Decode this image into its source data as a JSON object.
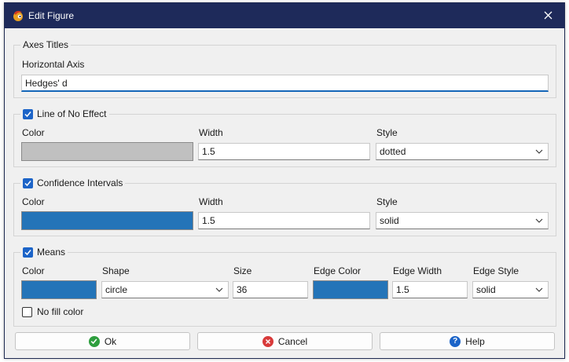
{
  "window": {
    "title": "Edit Figure"
  },
  "axes_titles": {
    "legend": "Axes Titles",
    "horizontal_label": "Horizontal Axis",
    "horizontal_value": "Hedges' d"
  },
  "line_no_effect": {
    "legend": "Line of No Effect",
    "checked": true,
    "color_label": "Color",
    "color": "#c0c0c0",
    "width_label": "Width",
    "width_value": "1.5",
    "style_label": "Style",
    "style_value": "dotted"
  },
  "confidence_intervals": {
    "legend": "Confidence Intervals",
    "checked": true,
    "color_label": "Color",
    "color": "#2474b8",
    "width_label": "Width",
    "width_value": "1.5",
    "style_label": "Style",
    "style_value": "solid"
  },
  "means": {
    "legend": "Means",
    "checked": true,
    "color_label": "Color",
    "color": "#2474b8",
    "shape_label": "Shape",
    "shape_value": "circle",
    "size_label": "Size",
    "size_value": "36",
    "edge_color_label": "Edge Color",
    "edge_color": "#2474b8",
    "edge_width_label": "Edge Width",
    "edge_width_value": "1.5",
    "edge_style_label": "Edge Style",
    "edge_style_value": "solid",
    "no_fill_label": "No fill color",
    "no_fill_checked": false
  },
  "buttons": {
    "ok": "Ok",
    "cancel": "Cancel",
    "help": "Help"
  },
  "icons": {
    "app": "app-logo-icon",
    "close": "close-icon",
    "checkbox": "checkbox-icon",
    "chevron": "chevron-down-icon",
    "ok": "check-circle-icon",
    "cancel": "cancel-circle-icon",
    "help": "help-circle-icon"
  },
  "colors": {
    "titlebar": "#1e2a5a",
    "accent": "#1c64c8",
    "ok_green": "#2e9e3e",
    "cancel_red": "#d83a3a",
    "help_blue": "#1c64c8"
  }
}
